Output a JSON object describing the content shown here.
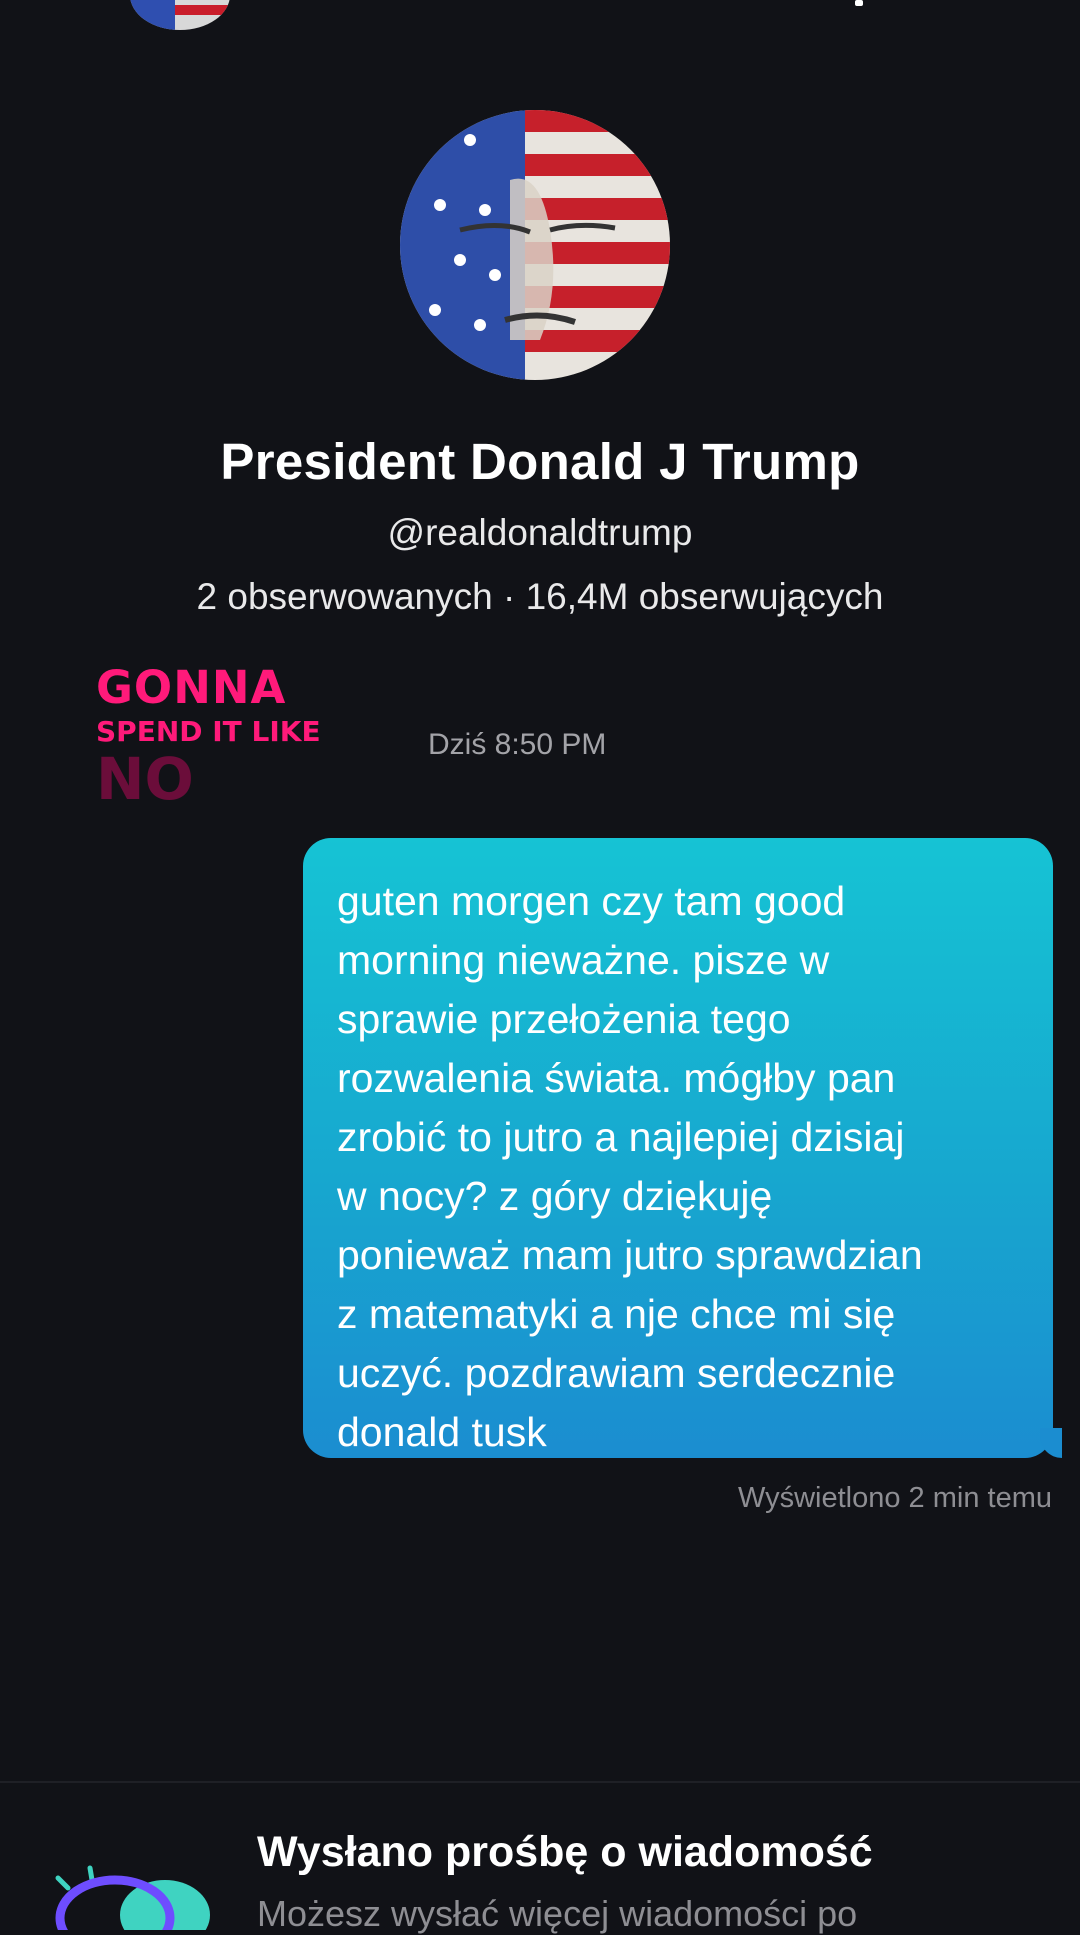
{
  "profile": {
    "name": "President Donald J Trump",
    "handle": "@realdonaldtrump",
    "stats": "2 obserwowanych · 16,4M obserwujących"
  },
  "sticker": {
    "line1": "GONNA",
    "line2": "SPEND IT LIKE",
    "line3": "NO"
  },
  "conversation": {
    "timestamp": "Dziś 8:50 PM",
    "message": "guten morgen czy tam good\nmorning nieważne.  pisze w\nsprawie przełożenia tego\nrozwalenia świata. mógłby pan\nzrobić to jutro a najlepiej dzisiaj\nw nocy? z góry dziękuję\nponieważ mam jutro sprawdzian\nz matematyki a nje chce mi się\nuczyć. pozdrawiam serdecznie\ndonald tusk",
    "seen_status": "Wyświetlono 2 min temu"
  },
  "request_banner": {
    "title": "Wysłano prośbę o wiadomość",
    "subtitle": "Możesz wysłać więcej wiadomości po"
  },
  "colors": {
    "background": "#111217",
    "bubble_top": "#16c3d4",
    "bubble_bottom": "#1b8dd0",
    "sticker_pink": "#ff1a7a",
    "sticker_dark": "#6b0d3a"
  },
  "icons": {
    "avatar": "american-flag-face-avatar",
    "banner": "message-request-icon"
  }
}
